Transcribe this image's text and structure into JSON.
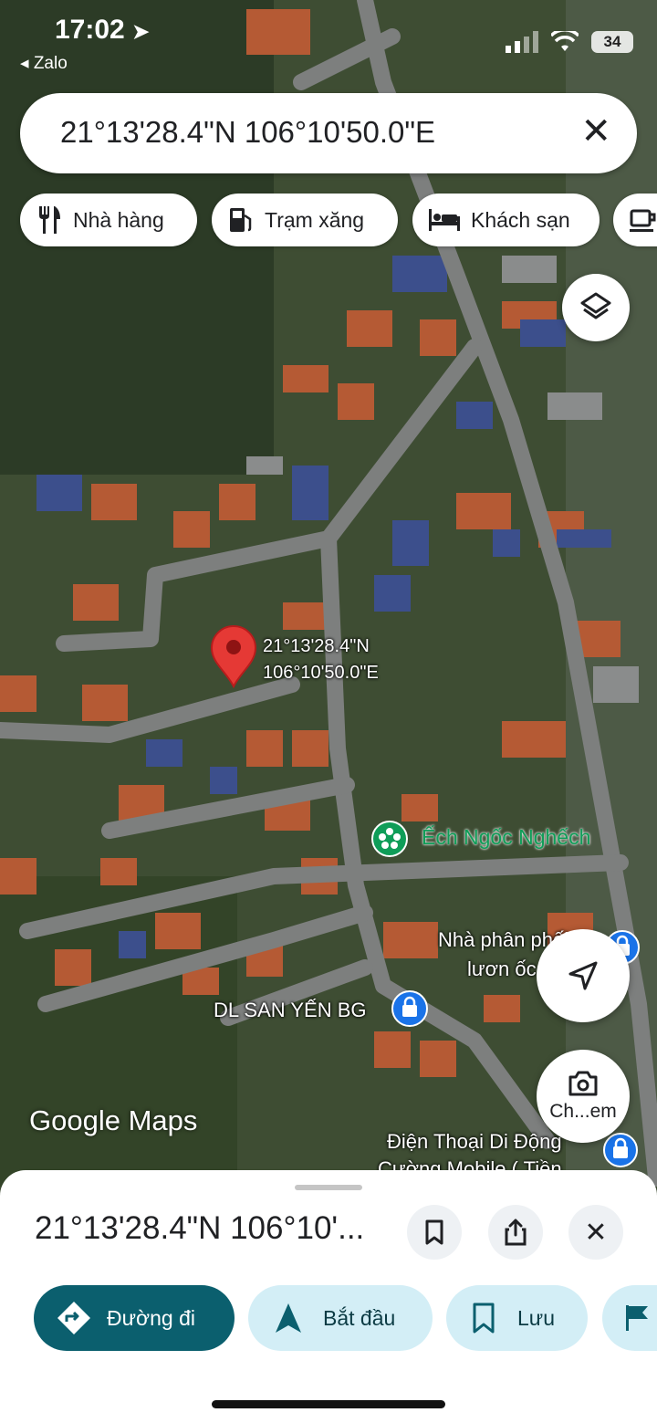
{
  "status_bar": {
    "time": "17:02",
    "back_app": "◂ Zalo",
    "battery": "34"
  },
  "search": {
    "value": "21°13'28.4\"N 106°10'50.0\"E"
  },
  "chips": [
    {
      "label": "Nhà hàng",
      "icon": "restaurant-icon"
    },
    {
      "label": "Trạm xăng",
      "icon": "gas-station-icon"
    },
    {
      "label": "Khách sạn",
      "icon": "hotel-icon"
    },
    {
      "label": "",
      "icon": "coffee-icon"
    }
  ],
  "map": {
    "pin_label_line1": "21°13'28.4\"N",
    "pin_label_line2": "106°10'50.0\"E",
    "poi": [
      {
        "name": "Ếch Ngốc Nghếch",
        "color": "#0f9d58"
      },
      {
        "name": "Nhà phân phối",
        "sub": "lươn ốc"
      },
      {
        "name": "DL SAN YẾN BG"
      },
      {
        "name": "Điện Thoại Di Động",
        "sub": "Cường Mobile ( Tiền"
      }
    ],
    "watermark": "Google Maps",
    "camera_label": "Ch...em"
  },
  "sheet": {
    "title": "21°13'28.4\"N 106°10'...",
    "actions": [
      {
        "label": "Đường đi",
        "primary": true
      },
      {
        "label": "Bắt đầu"
      },
      {
        "label": "Lưu"
      }
    ]
  },
  "colors": {
    "primary": "#0b5f6e",
    "action_bg": "#d3eef6",
    "pin": "#e53935"
  }
}
